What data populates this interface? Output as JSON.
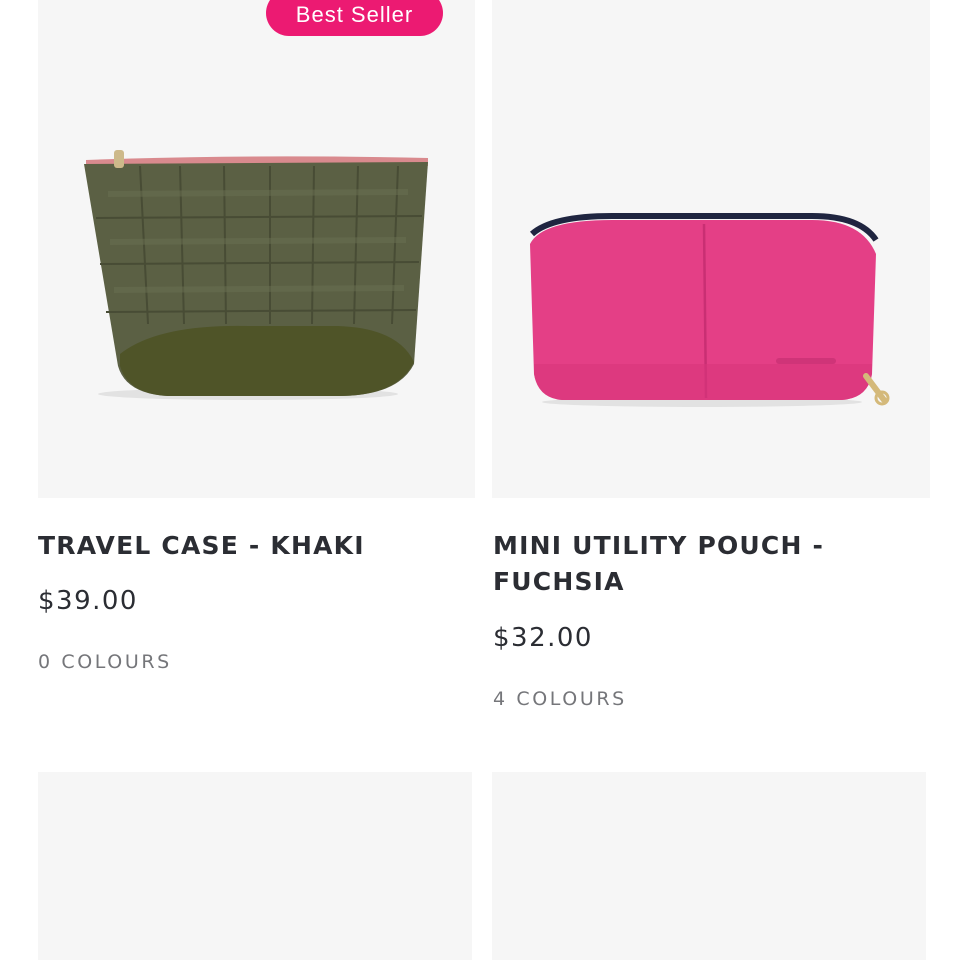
{
  "colors": {
    "badge_bg": "#ec1a72",
    "text_primary": "#2b2d33",
    "text_secondary": "#75767a",
    "image_bg": "#f6f6f6"
  },
  "products": [
    {
      "badge": "Best Seller",
      "title": "TRAVEL CASE - KHAKI",
      "price": "$39.00",
      "colours": "0 COLOURS",
      "image_icon": "khaki-quilted-travel-case"
    },
    {
      "badge": "",
      "title": "MINI UTILITY POUCH - FUCHSIA",
      "price": "$32.00",
      "colours": "4 COLOURS",
      "image_icon": "fuchsia-leather-pouch"
    },
    {
      "badge": "",
      "title": "",
      "price": "",
      "colours": "",
      "image_icon": "image-placeholder"
    },
    {
      "badge": "",
      "title": "",
      "price": "",
      "colours": "",
      "image_icon": "image-placeholder"
    }
  ]
}
